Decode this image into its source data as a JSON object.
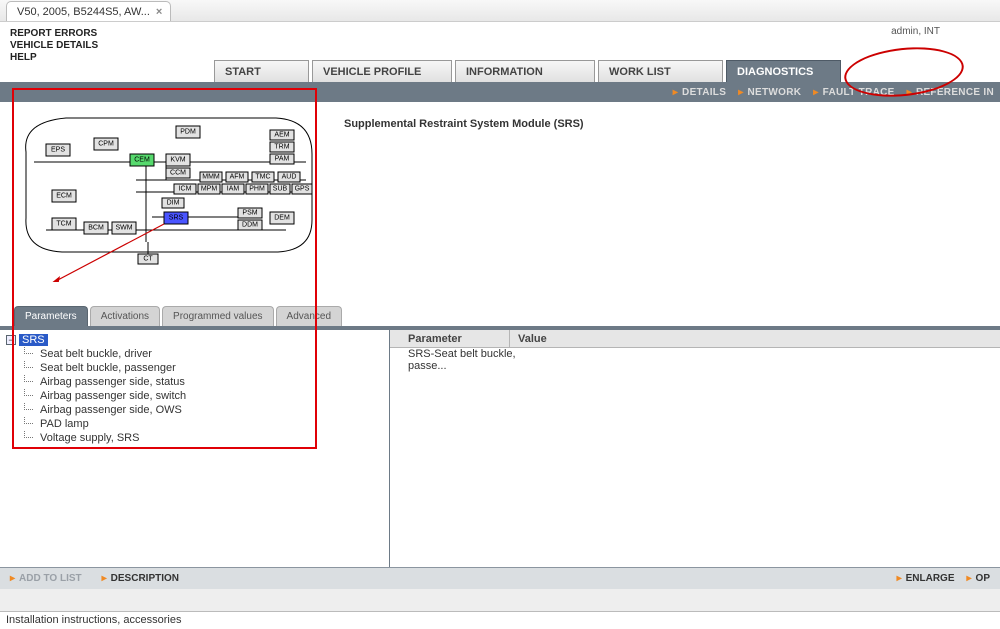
{
  "browser_tab": "V50, 2005, B5244S5, AW...",
  "left_menu": [
    "REPORT ERRORS",
    "VEHICLE DETAILS",
    "HELP"
  ],
  "user_text": "admin, INT",
  "nav_tabs": [
    "START",
    "VEHICLE PROFILE",
    "INFORMATION",
    "WORK LIST",
    "DIAGNOSTICS"
  ],
  "nav_active": 4,
  "sub_links": [
    "DETAILS",
    "NETWORK",
    "FAULT TRACE",
    "REFERENCE IN"
  ],
  "module_title": "Supplemental Restraint System Module (SRS)",
  "modules": [
    "EPS",
    "CPM",
    "PDM",
    "AEM",
    "TRM",
    "PAM",
    "CEM",
    "KVM",
    "CCM",
    "MMM",
    "AFM",
    "TMC",
    "AUD",
    "ICM",
    "MPM",
    "IAM",
    "PHM",
    "SUB",
    "GPS",
    "DIM",
    "ECM",
    "TCM",
    "BCM",
    "SWM",
    "SRS",
    "PSM",
    "DDM",
    "DEM",
    "CT"
  ],
  "param_tabs": [
    "Parameters",
    "Activations",
    "Programmed values",
    "Advanced"
  ],
  "param_active": 0,
  "tree_root": "SRS",
  "tree_items": [
    "Seat belt buckle, driver",
    "Seat belt buckle, passenger",
    "Airbag passenger side, status",
    "Airbag passenger side, switch",
    "Airbag passenger side, OWS",
    "PAD lamp",
    "Voltage supply, SRS"
  ],
  "table_headers": {
    "c1": "Parameter",
    "c2": "Value"
  },
  "table_row": {
    "param": "SRS-Seat belt buckle, passe...",
    "value": ""
  },
  "actions": {
    "add": "ADD TO LIST",
    "desc": "DESCRIPTION",
    "enlarge": "ENLARGE",
    "op": "OP"
  },
  "status_text": "Installation instructions, accessories"
}
